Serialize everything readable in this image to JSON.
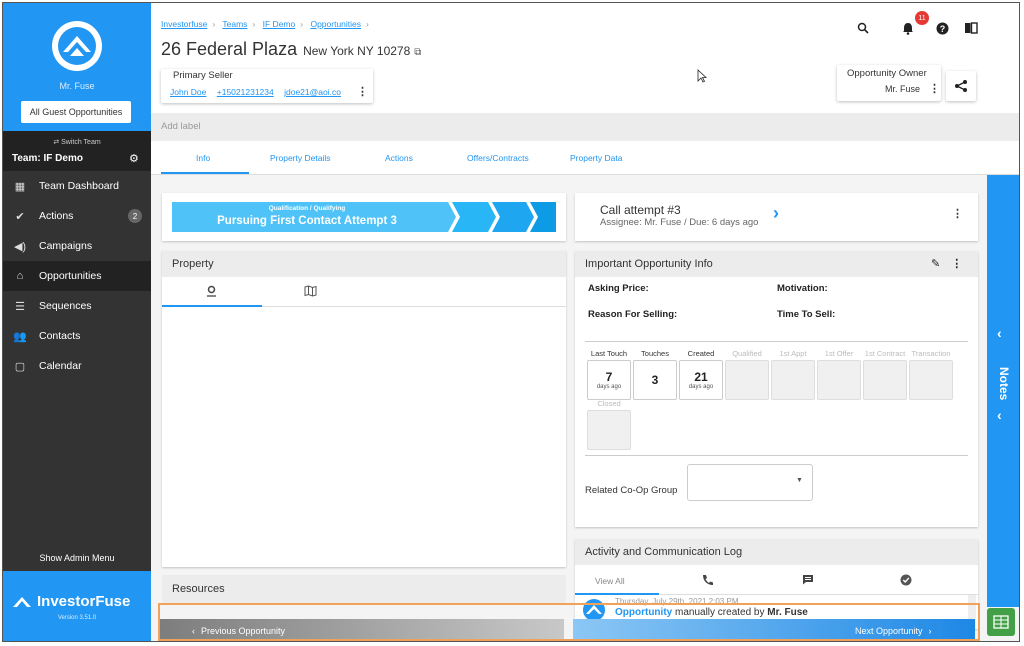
{
  "sidebar": {
    "username": "Mr. Fuse",
    "guest_button": "All Guest Opportunities",
    "switch_team": "Switch Team",
    "team_name": "Team: IF Demo",
    "nav": [
      {
        "label": "Team Dashboard",
        "icon": "dashboard-icon"
      },
      {
        "label": "Actions",
        "icon": "check-circle-icon",
        "badge": "2"
      },
      {
        "label": "Campaigns",
        "icon": "megaphone-icon"
      },
      {
        "label": "Opportunities",
        "icon": "home-icon",
        "active": true
      },
      {
        "label": "Sequences",
        "icon": "sequence-icon"
      },
      {
        "label": "Contacts",
        "icon": "people-icon"
      },
      {
        "label": "Calendar",
        "icon": "calendar-icon"
      }
    ],
    "admin_menu": "Show Admin Menu",
    "brand": "InvestorFuse",
    "version": "Version 3.51.0"
  },
  "header": {
    "breadcrumbs": [
      "Investorfuse",
      "Teams",
      "IF Demo",
      "Opportunities"
    ],
    "title": "26 Federal Plaza",
    "subtitle": "New York NY 10278",
    "seller_label": "Primary Seller",
    "seller_name": "John Doe",
    "seller_phone": "+15021231234",
    "seller_email": "jdoe21@aoi.co",
    "notification_count": "11",
    "owner_label": "Opportunity Owner",
    "owner_name": "Mr. Fuse",
    "add_label_placeholder": "Add label"
  },
  "tabs": [
    "Info",
    "Property Details",
    "Actions",
    "Offers/Contracts",
    "Property Data"
  ],
  "pipeline": {
    "stage_group": "Qualification / Qualifying",
    "stage": "Pursuing First Contact Attempt 3"
  },
  "property_card": {
    "title": "Property"
  },
  "resources_card": {
    "title": "Resources"
  },
  "call_card": {
    "title": "Call attempt #3",
    "subtitle": "Assignee: Mr. Fuse / Due: 6 days ago"
  },
  "info_card": {
    "title": "Important Opportunity Info",
    "asking_price": "Asking Price:",
    "motivation": "Motivation:",
    "reason": "Reason For Selling:",
    "time_to_sell": "Time To Sell:",
    "metrics": [
      {
        "label": "Last Touch",
        "value": "7",
        "unit": "days ago"
      },
      {
        "label": "Touches",
        "value": "3",
        "unit": ""
      },
      {
        "label": "Created",
        "value": "21",
        "unit": "days ago"
      },
      {
        "label": "Qualified",
        "value": "",
        "unit": ""
      },
      {
        "label": "1st Appt",
        "value": "",
        "unit": ""
      },
      {
        "label": "1st Offer",
        "value": "",
        "unit": ""
      },
      {
        "label": "1st Contract",
        "value": "",
        "unit": ""
      },
      {
        "label": "Transaction",
        "value": "",
        "unit": ""
      },
      {
        "label": "Closed",
        "value": "",
        "unit": ""
      }
    ],
    "coop_label": "Related Co-Op Group"
  },
  "activity": {
    "title": "Activity and Communication Log",
    "view_all": "View All",
    "entry_date": "Thursday, July 29th, 2021 2:03 PM",
    "entry_subject": "Opportunity",
    "entry_middle": "manually created by",
    "entry_user": "Mr. Fuse"
  },
  "notes_panel": {
    "label": "Notes"
  },
  "footer": {
    "prev": "Previous Opportunity",
    "next": "Next Opportunity"
  },
  "colors": {
    "brand_blue": "#2196f3",
    "sidebar_dark": "#333333",
    "badge_red": "#e53935",
    "highlight_orange": "#f0a25a"
  }
}
